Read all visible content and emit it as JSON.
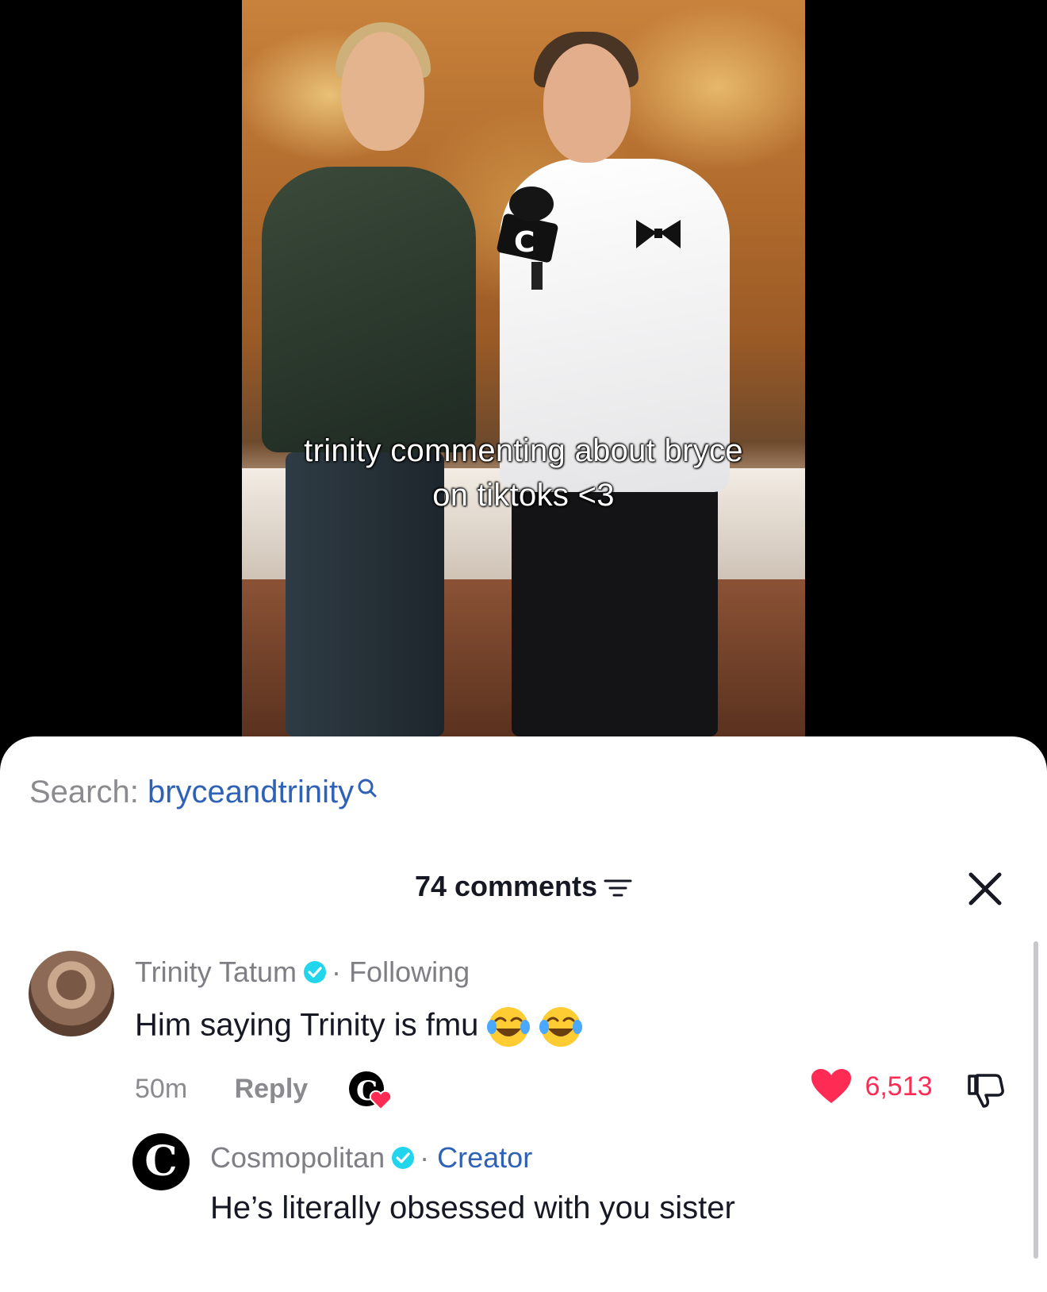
{
  "video": {
    "caption_line1": "trinity commenting about bryce",
    "caption_line2": "on tiktoks <3",
    "mic_logo": "C"
  },
  "search": {
    "prefix": "Search:",
    "term": "bryceandtrinity",
    "icon": "search-icon"
  },
  "comments_header": {
    "count_label": "74 comments",
    "sort_icon": "sort-icon",
    "close_icon": "close-icon"
  },
  "comments": [
    {
      "author": "Trinity Tatum",
      "verified": true,
      "relation": "Following",
      "text": "Him saying Trinity is fmu",
      "emoji": "face-with-tears-of-joy x2",
      "time": "50m",
      "reply_label": "Reply",
      "likes": "6,513",
      "liked": true,
      "creator_liked": true,
      "reply": {
        "avatar_letter": "C",
        "author": "Cosmopolitan",
        "verified": true,
        "badge": "Creator",
        "text": "He’s literally obsessed with you sister"
      }
    }
  ],
  "colors": {
    "like": "#fe2c55",
    "link": "#2f62b6",
    "verified": "#20d5ec",
    "text": "#161823",
    "muted": "#8a8a8f"
  },
  "separator": "·"
}
